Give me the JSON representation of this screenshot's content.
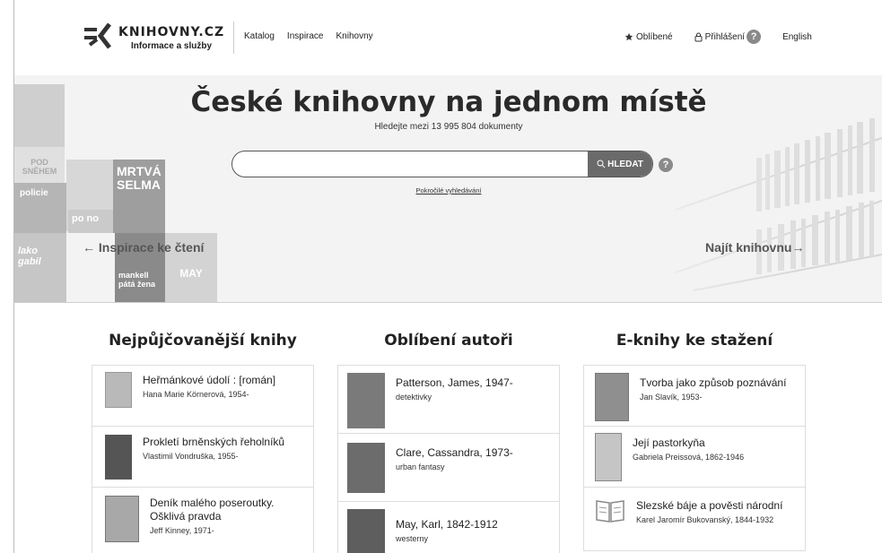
{
  "header": {
    "logo_name": "KNIHOVNY.CZ",
    "logo_tagline": "Informace a služby",
    "nav": [
      "Katalog",
      "Inspirace",
      "Knihovny"
    ],
    "favorites_label": "Oblíbené",
    "login_label": "Přihlášení",
    "help_glyph": "?",
    "language_label": "English"
  },
  "hero": {
    "title": "České knihovny na jednom místě",
    "subtitle": "Hledejte mezi 13 995 804 dokumenty",
    "search_value": "",
    "search_button": "HLEDAT",
    "help_glyph": "?",
    "advanced_search": "Pokročilé vyhledávání",
    "left_link": "← Inspirace ke čtení",
    "right_link": "Najít knihovnu→",
    "book_covers": [
      "POD SNĚHEM",
      "policie",
      "MRTVÁ SELMA",
      "po no",
      "lako gabil",
      "mankell pátá žena",
      "MAY"
    ]
  },
  "sections": [
    {
      "title": "Nejpůjčovanější knihy",
      "items": [
        {
          "title": "Heřmánkové údolí : [román]",
          "subtitle": "Hana Marie Körnerová, 1954-"
        },
        {
          "title": "Prokletí brněnských řeholníků",
          "subtitle": "Vlastimil Vondruška, 1955-"
        },
        {
          "title": "Deník malého poseroutky. Ošklivá pravda",
          "subtitle": "Jeff Kinney, 1971-"
        }
      ]
    },
    {
      "title": "Oblíbení autoři",
      "items": [
        {
          "title": "Patterson, James, 1947-",
          "subtitle": "detektivky"
        },
        {
          "title": "Clare, Cassandra, 1973-",
          "subtitle": "urban fantasy"
        },
        {
          "title": "May, Karl, 1842-1912",
          "subtitle": "westerny"
        }
      ]
    },
    {
      "title": "E-knihy ke stažení",
      "items": [
        {
          "title": "Tvorba jako způsob poznávání",
          "subtitle": "Jan Slavík, 1953-"
        },
        {
          "title": "Její pastorkyňa",
          "subtitle": "Gabriela Preissová, 1862-1946"
        },
        {
          "title": "Slezské báje a pověsti národní",
          "subtitle": "Karel Jaromír Bukovanský, 1844-1932"
        }
      ]
    }
  ],
  "colors": {
    "text": "#222222",
    "hero_bg": "#f3f3f3",
    "button_bg": "#6a6a6a",
    "border": "#dddddd"
  }
}
